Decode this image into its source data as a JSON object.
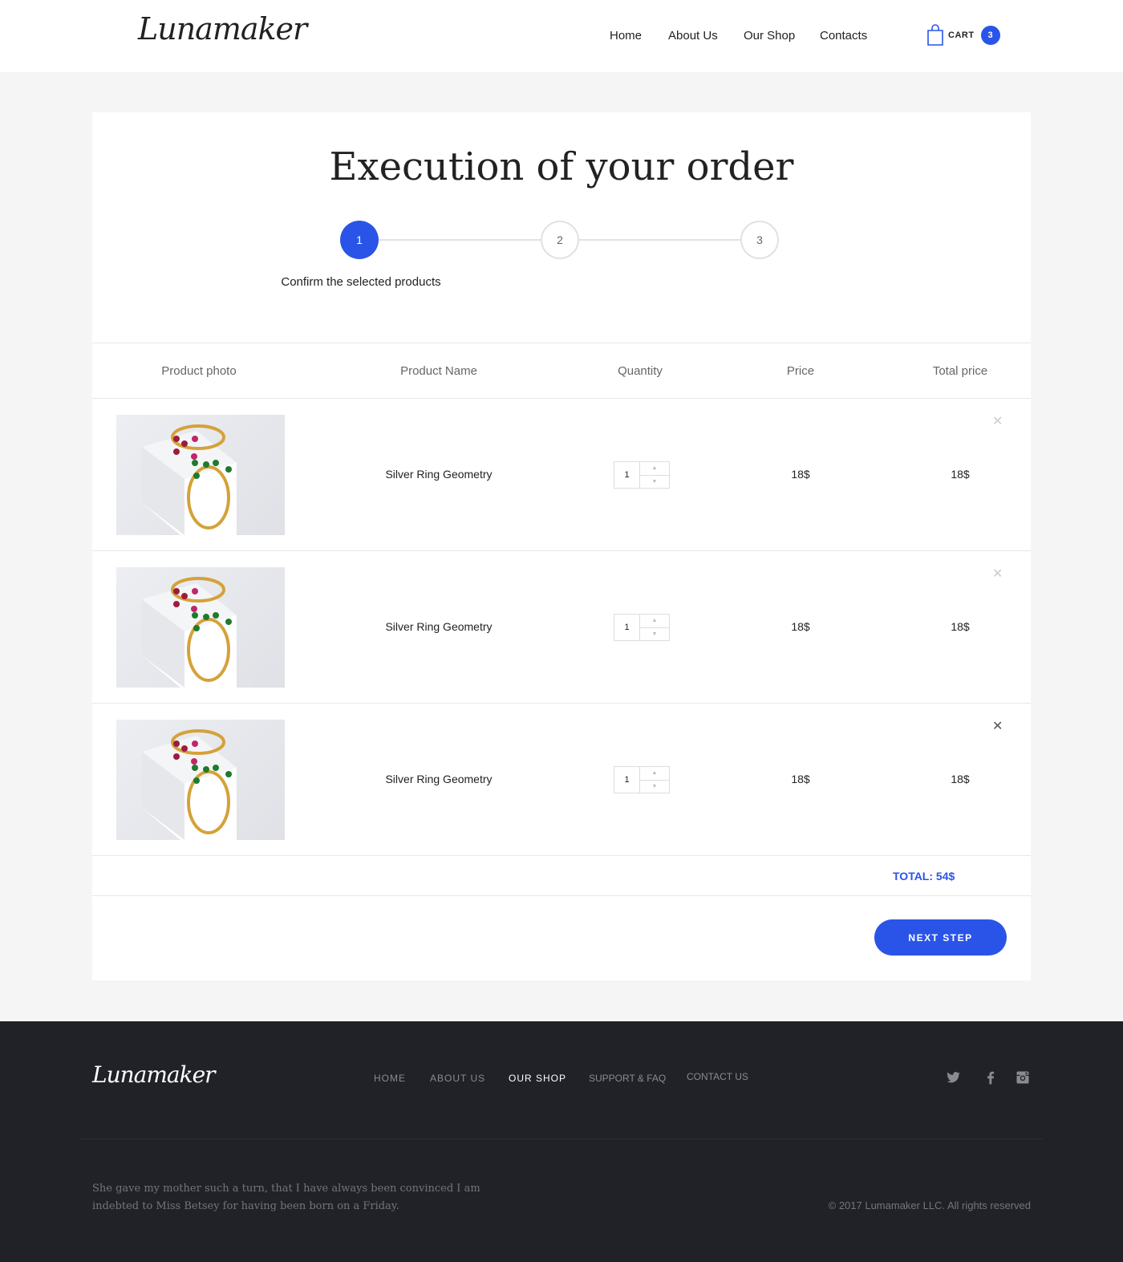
{
  "header": {
    "logo": "Lunamaker",
    "nav": [
      "Home",
      "About Us",
      "Our Shop",
      "Contacts"
    ],
    "cart_label": "CART",
    "cart_count": "3"
  },
  "page": {
    "title": "Execution of your order",
    "steps": [
      "1",
      "2",
      "3"
    ],
    "active_step_caption": "Confirm the selected products"
  },
  "table": {
    "headers": [
      "Product photo",
      "Product Name",
      "Quantity",
      "Price",
      "Total price"
    ],
    "rows": [
      {
        "name": "Silver Ring Geometry",
        "quantity": "1",
        "price": "18$",
        "total": "18$"
      },
      {
        "name": "Silver Ring Geometry",
        "quantity": "1",
        "price": "18$",
        "total": "18$"
      },
      {
        "name": "Silver Ring Geometry",
        "quantity": "1",
        "price": "18$",
        "total": "18$"
      }
    ],
    "total": "TOTAL: 54$"
  },
  "next_button": "NEXT STEP",
  "footer": {
    "logo": "Lunamaker",
    "nav": [
      "HOME",
      "ABOUT US",
      "OUR SHOP",
      "SUPPORT & FAQ",
      "CONTACT US"
    ],
    "quote": "She gave my mother such a turn, that I have always been convinced I am indebted to Miss Betsey for having been born on a Friday.",
    "copyright": "© 2017 Lumamaker LLC. All rights reserved"
  },
  "colors": {
    "accent": "#2a54e8",
    "footer_bg": "#212227"
  }
}
